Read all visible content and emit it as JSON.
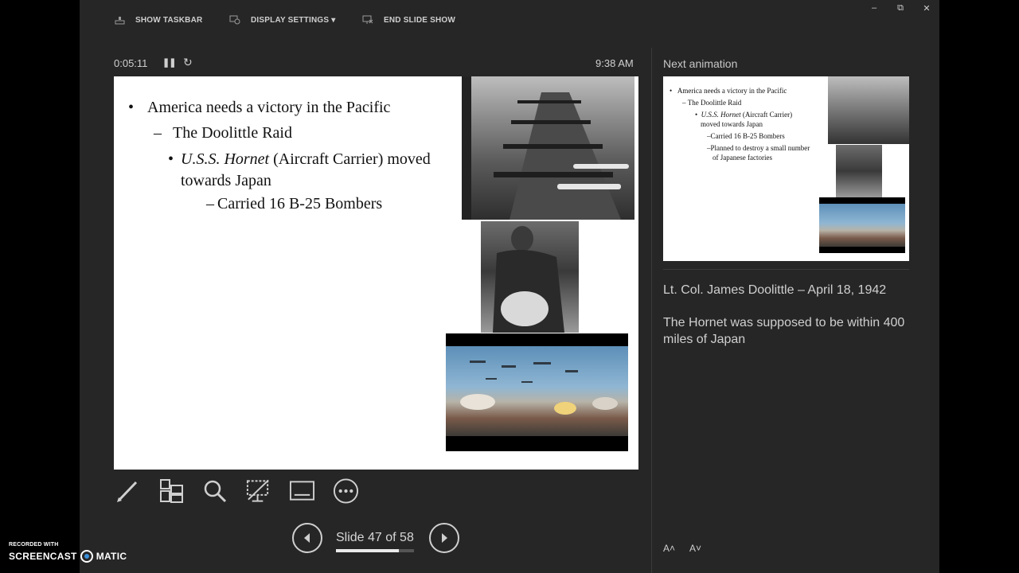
{
  "toolbar": {
    "show_taskbar": "SHOW TASKBAR",
    "display_settings": "DISPLAY SETTINGS ▾",
    "end_slide_show": "END SLIDE SHOW",
    "minimize": "–",
    "restore": "⧉",
    "close": "✕"
  },
  "presenter": {
    "elapsed_time": "0:05:11",
    "clock": "9:38 AM",
    "pause_icon": "pause-icon",
    "reset_icon": "reset-icon"
  },
  "current_slide": {
    "bullet_1": "America needs a victory in the Pacific",
    "bullet_2": "The Doolittle Raid",
    "bullet_3_italic": "U.S.S. Hornet",
    "bullet_3_rest": " (Aircraft Carrier) moved towards Japan",
    "bullet_4": "Carried 16 B-25 Bombers",
    "dash": "–",
    "dot": "•"
  },
  "tools": [
    "pen-icon",
    "slides-grid-icon",
    "zoom-icon",
    "black-screen-icon",
    "subtitles-icon",
    "more-options-icon"
  ],
  "navigation": {
    "slide_counter": "Slide 47 of 58",
    "progress": 0.81
  },
  "next_panel": {
    "label": "Next animation",
    "slide_lines": {
      "l1": "America needs a victory in the Pacific",
      "l2": "The Doolittle Raid",
      "l3_italic": "U.S.S. Hornet",
      "l3_rest": " (Aircraft Carrier)",
      "l3_cont": "moved towards Japan",
      "l4": "Carried 16 B-25 Bombers",
      "l5": "Planned to destroy a small number",
      "l5_cont": "of Japanese factories"
    }
  },
  "notes": {
    "p1": "Lt. Col. James Doolittle – April 18, 1942",
    "p2": "The Hornet was supposed to be within 400 miles of Japan"
  },
  "font_controls": {
    "increase": "A˄",
    "decrease": "A˅"
  },
  "watermark": {
    "top": "RECORDED WITH",
    "left": "SCREENCAST",
    "right": "MATIC"
  },
  "colors": {
    "background": "#262626",
    "slide": "#ffffff",
    "text": "#d6d6d6"
  }
}
